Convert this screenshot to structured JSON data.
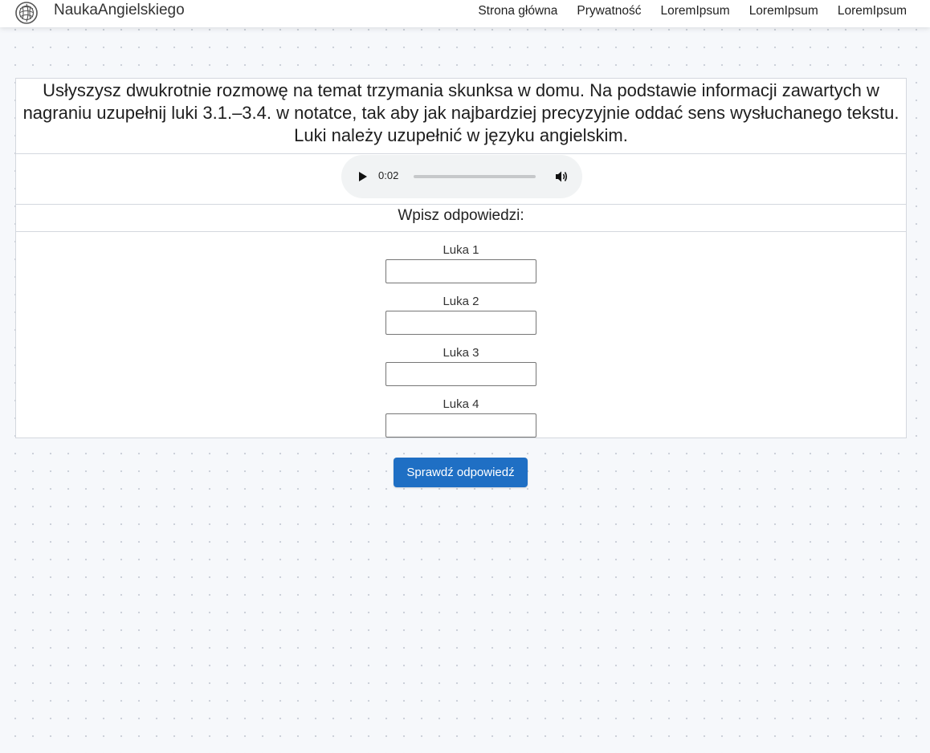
{
  "navbar": {
    "brand": "NaukaAngielskiego",
    "logo_icon": "globe-knot-logo-icon",
    "links": [
      "Strona główna",
      "Prywatność",
      "LoremIpsum",
      "LoremIpsum",
      "LoremIpsum"
    ]
  },
  "exercise": {
    "instruction": "Usłyszysz dwukrotnie rozmowę na temat trzymania skunksa w domu. Na podstawie informacji zawartych w nagraniu uzupełnij luki 3.1.–3.4. w notatce, tak aby jak najbardziej precyzyjnie oddać sens wysłuchanego tekstu. Luki należy uzupełnić w języku angielskim.",
    "audio": {
      "time": "0:02",
      "play_icon": "play-icon",
      "volume_icon": "volume-icon",
      "progress": 0
    },
    "answers_heading": "Wpisz odpowiedzi:",
    "gaps": [
      {
        "label": "Luka 1",
        "value": ""
      },
      {
        "label": "Luka 2",
        "value": ""
      },
      {
        "label": "Luka 3",
        "value": ""
      },
      {
        "label": "Luka 4",
        "value": ""
      }
    ],
    "submit_label": "Sprawdź odpowiedź"
  },
  "colors": {
    "primary_button": "#1f6fc4",
    "page_background": "#f6f8fb",
    "border": "#d4d8de"
  }
}
